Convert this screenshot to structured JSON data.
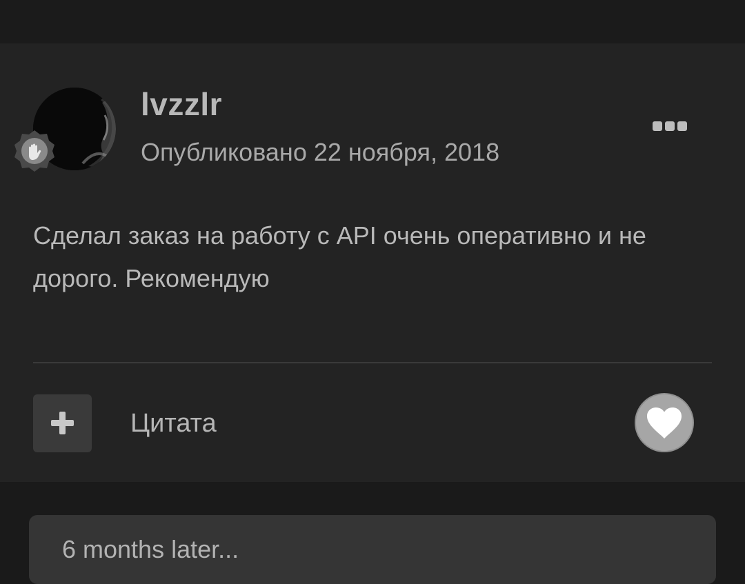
{
  "post": {
    "author": "lvzzlr",
    "published": "Опубликовано 22 ноября, 2018",
    "content": "Сделал заказ на работу с API очень оперативно и не дорого. Рекомендую",
    "quote_label": "Цитата",
    "icons": {
      "avatar": "user-avatar",
      "badge": "waving-hand-badge-icon",
      "more": "ellipsis-icon",
      "plus": "plus-icon",
      "like": "heart-icon"
    }
  },
  "time_gap": {
    "label": "6 months later..."
  },
  "colors": {
    "page_background": "#1a1a1a",
    "post_background": "#232323",
    "button_background": "#3a3a3a",
    "like_background": "#a6a6a6",
    "text": "#b9b9b9"
  }
}
